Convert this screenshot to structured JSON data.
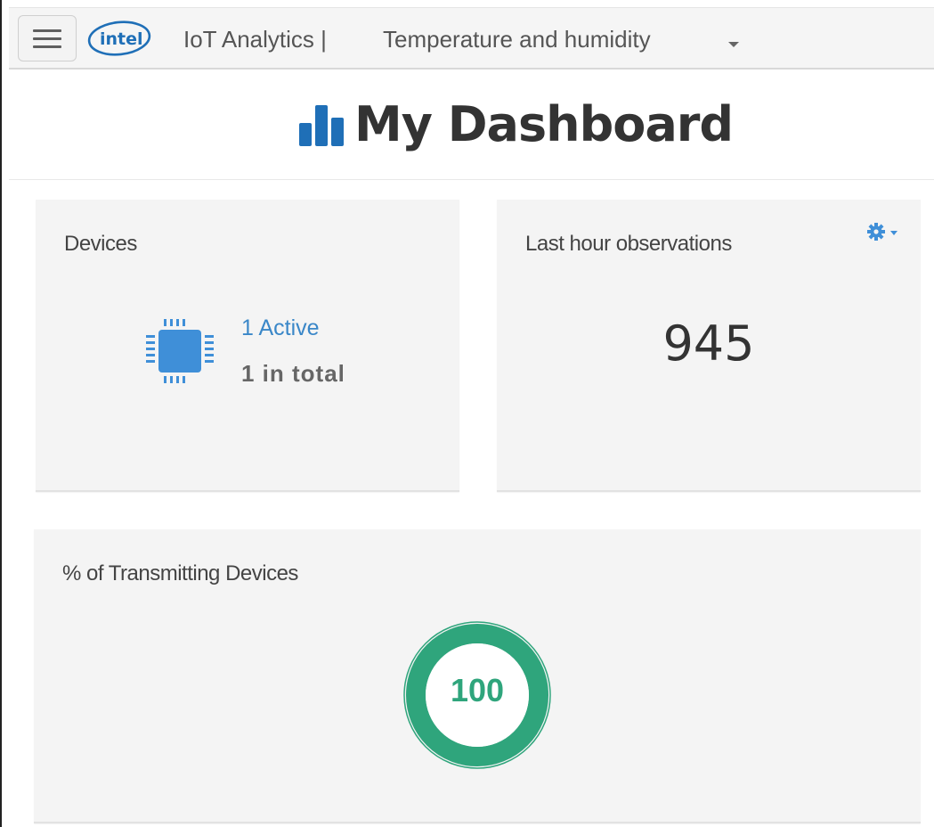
{
  "header": {
    "menu_icon": "hamburger-menu-icon",
    "logo_text": "intel",
    "brand": "IoT Analytics |",
    "account": "Temperature and humidity",
    "account_caret_icon": "caret-down-icon"
  },
  "page": {
    "title": "My Dashboard",
    "title_icon": "bar-chart-icon"
  },
  "cards": {
    "devices": {
      "title": "Devices",
      "icon": "chip-icon",
      "active": "1 Active",
      "total": "1 in total"
    },
    "observations": {
      "title": "Last hour observations",
      "value": "945",
      "settings_icon": "gear-icon"
    },
    "transmitting": {
      "title": "% of Transmitting Devices",
      "value": "100",
      "percent": 100
    }
  },
  "colors": {
    "accent_blue": "#3a87c8",
    "chip_blue": "#3f8fd8",
    "gauge_green": "#2fa57c",
    "card_bg": "#f4f4f4"
  }
}
